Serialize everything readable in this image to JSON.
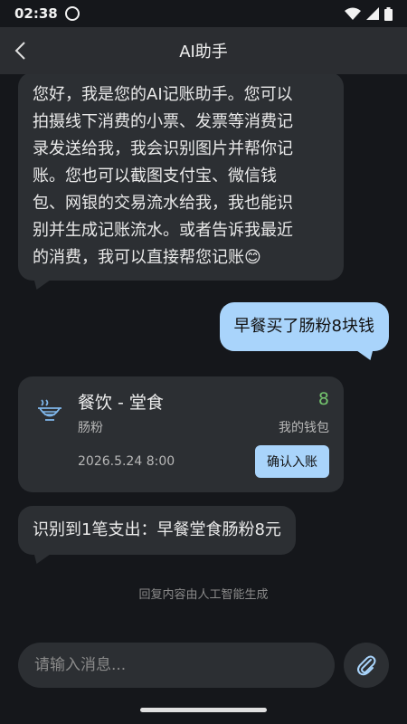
{
  "status_bar": {
    "time": "02:38"
  },
  "header": {
    "title": "AI助手"
  },
  "messages": {
    "ai_intro_lines": [
      "您好，我是您的AI记账助手。您可以",
      "拍摄线下消费的小票、发票等消费记",
      "录发送给我，我会识别图片并帮你记",
      "账。您也可以截图支付宝、微信钱",
      "包、网银的交易流水给我，我也能识",
      "别并生成记账流水。或者告诉我最近",
      "的消费，我可以直接帮您记账😊"
    ],
    "user_msg": "早餐买了肠粉8块钱",
    "record_card": {
      "category": "餐饮 - 堂食",
      "item": "肠粉",
      "amount": "8",
      "account": "我的钱包",
      "datetime": "2026.5.24 8:00",
      "confirm_label": "确认入账",
      "icon": "noodle-bowl-icon"
    },
    "ai_result": "识别到1笔支出：早餐堂食肠粉8元"
  },
  "disclaimer": "回复内容由人工智能生成",
  "input": {
    "placeholder": "请输入消息..."
  },
  "colors": {
    "background": "#15171b",
    "bubble_ai": "#2c2f33",
    "bubble_user": "#a9d4fb",
    "amount_green": "#74c46e"
  }
}
